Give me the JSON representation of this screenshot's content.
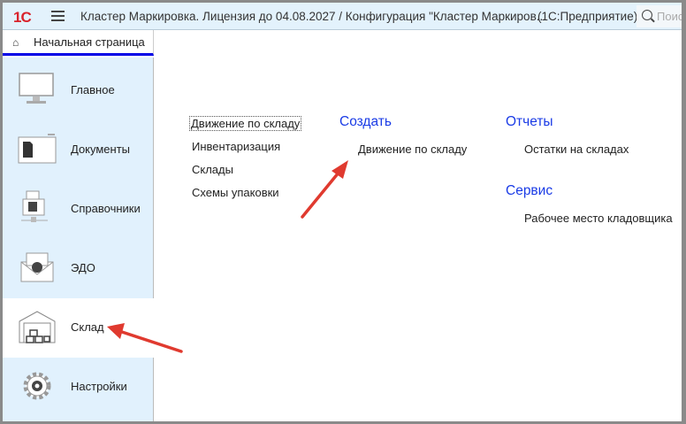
{
  "titlebar": {
    "logo": "1С",
    "title": "Кластер Маркировка. Лицензия до 04.08.2027 / Конфигурация \"Кластер Маркиров...",
    "app": "(1С:Предприятие)",
    "search_placeholder": "Поиск"
  },
  "tabs": {
    "home": "Начальная страница"
  },
  "sidebar": {
    "items": [
      {
        "label": "Главное",
        "icon": "monitor-icon"
      },
      {
        "label": "Документы",
        "icon": "documents-folder-icon"
      },
      {
        "label": "Справочники",
        "icon": "fax-directory-icon"
      },
      {
        "label": "ЭДО",
        "icon": "secure-envelope-icon"
      },
      {
        "label": "Склад",
        "icon": "warehouse-icon",
        "selected": true
      },
      {
        "label": "Настройки",
        "icon": "gear-icon"
      }
    ]
  },
  "main": {
    "nav": [
      "Движение по складу",
      "Инвентаризация",
      "Склады",
      "Схемы упаковки"
    ],
    "create": {
      "title": "Создать",
      "items": [
        "Движение по складу"
      ]
    },
    "reports": {
      "title": "Отчеты",
      "items": [
        "Остатки на складах"
      ]
    },
    "service": {
      "title": "Сервис",
      "items": [
        "Рабочее место кладовщика"
      ]
    }
  },
  "colors": {
    "accent": "#1a3be6",
    "sidebar": "#e1f1fd",
    "arrow": "#e03a2f"
  }
}
